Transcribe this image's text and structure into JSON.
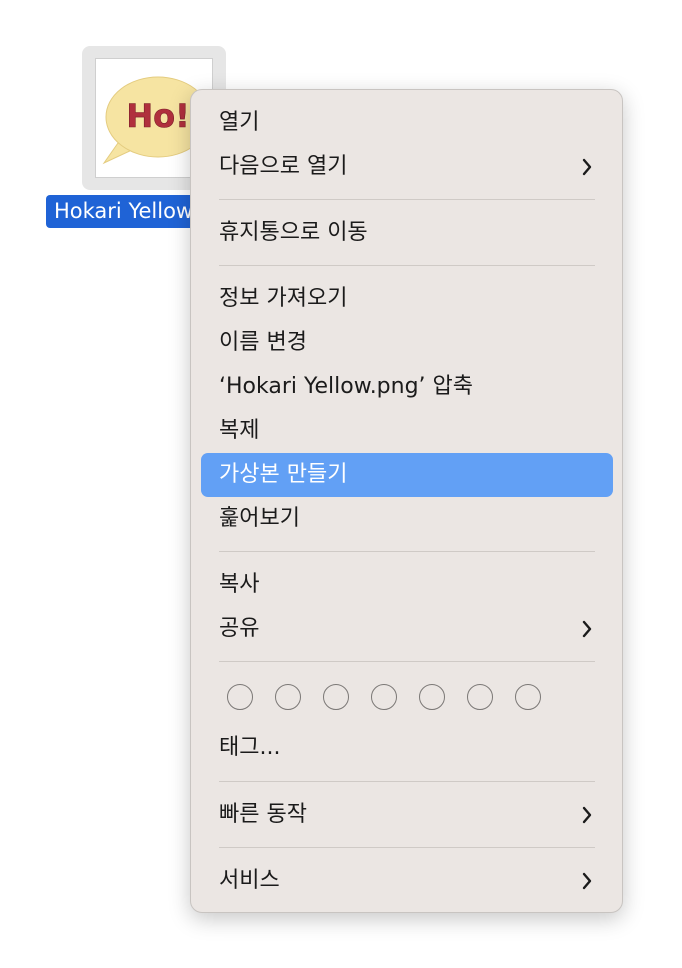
{
  "file": {
    "label": "Hokari Yellow",
    "thumb_text": "Ho!"
  },
  "menu": {
    "items": [
      {
        "label": "열기"
      },
      {
        "label": "다음으로 열기"
      },
      {
        "label": "휴지통으로 이동"
      },
      {
        "label": "정보 가져오기"
      },
      {
        "label": "이름 변경"
      },
      {
        "label": "‘Hokari Yellow.png’ 압축"
      },
      {
        "label": "복제"
      },
      {
        "label": "가상본 만들기"
      },
      {
        "label": "훑어보기"
      },
      {
        "label": "복사"
      },
      {
        "label": "공유"
      },
      {
        "label": "태그..."
      },
      {
        "label": "빠른 동작"
      },
      {
        "label": "서비스"
      }
    ],
    "highlighted": "가상본 만들기",
    "submenu_icon": "chevron-right-icon",
    "tag_count": 7
  },
  "colors": {
    "selection": "#1f63d6",
    "highlight": "#62a0f5",
    "menu_bg": "#ebe6e3"
  }
}
